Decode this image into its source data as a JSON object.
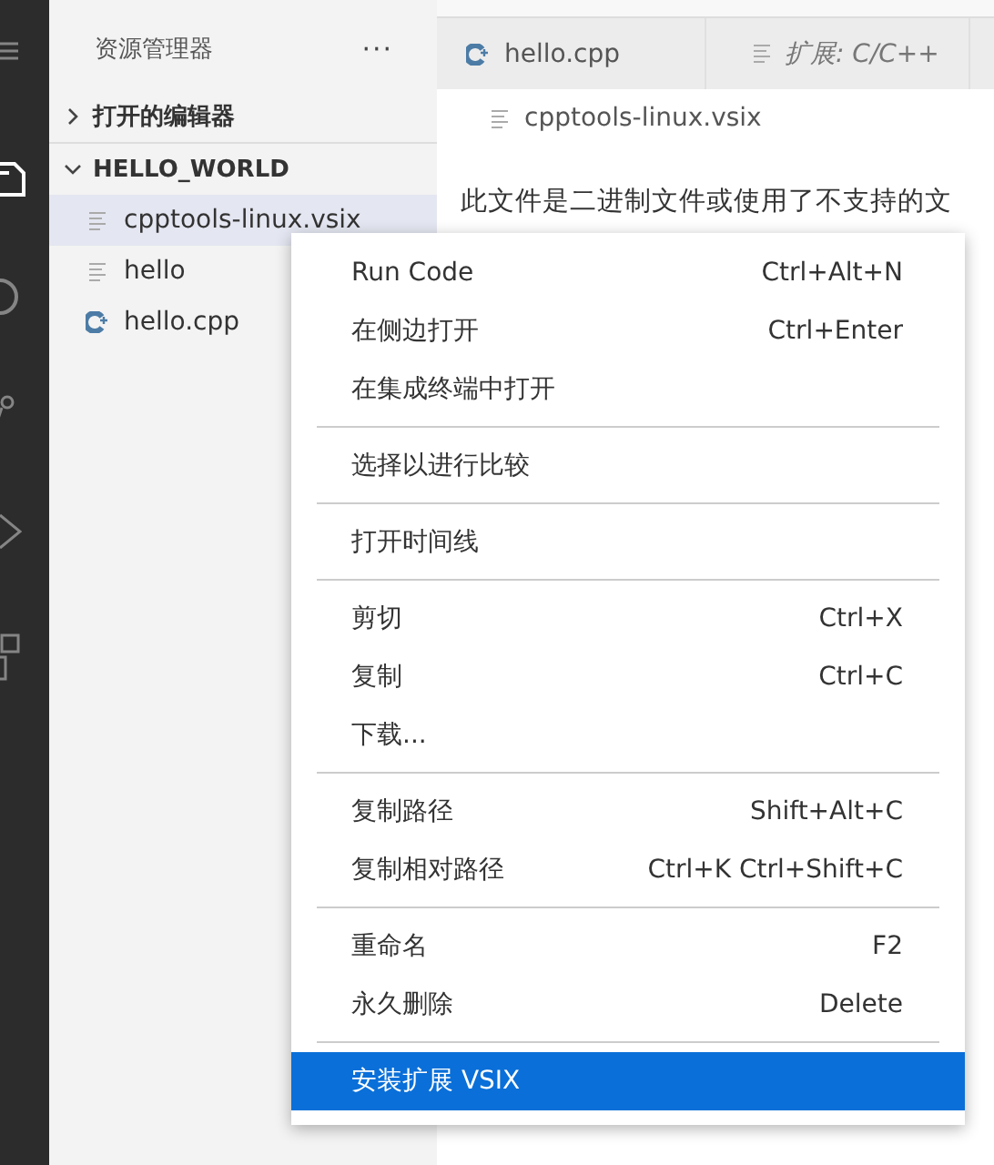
{
  "activity_bar": [
    {
      "kind": "menu",
      "selected": false
    },
    {
      "kind": "files",
      "selected": true
    },
    {
      "kind": "search",
      "selected": false
    },
    {
      "kind": "source-control",
      "selected": false
    },
    {
      "kind": "run",
      "selected": false
    },
    {
      "kind": "extensions",
      "selected": false
    }
  ],
  "sidebar": {
    "title": "资源管理器",
    "more": "···",
    "sections": [
      {
        "label": "打开的编辑器",
        "expanded": false
      },
      {
        "label": "HELLO_WORLD",
        "expanded": true,
        "files": [
          {
            "name": "cpptools-linux.vsix",
            "kind": "text",
            "selected": true
          },
          {
            "name": "hello",
            "kind": "text",
            "selected": false
          },
          {
            "name": "hello.cpp",
            "kind": "cpp",
            "selected": false
          }
        ]
      }
    ]
  },
  "tabs": [
    {
      "label": "hello.cpp",
      "kind": "cpp",
      "preview": false
    },
    {
      "label": "扩展: C/C++",
      "kind": "text",
      "preview": true
    }
  ],
  "breadcrumb": {
    "label": "cpptools-linux.vsix"
  },
  "message": "此文件是二进制文件或使用了不支持的文",
  "context_menu": {
    "groups": [
      [
        {
          "label": "Run Code",
          "shortcut": "Ctrl+Alt+N",
          "selected": false
        },
        {
          "label": "在侧边打开",
          "shortcut": "Ctrl+Enter",
          "selected": false
        },
        {
          "label": "在集成终端中打开",
          "selected": false
        }
      ],
      [
        {
          "label": "选择以进行比较",
          "selected": false
        }
      ],
      [
        {
          "label": "打开时间线",
          "selected": false
        }
      ],
      [
        {
          "label": "剪切",
          "shortcut": "Ctrl+X",
          "selected": false
        },
        {
          "label": "复制",
          "shortcut": "Ctrl+C",
          "selected": false
        },
        {
          "label": "下载...",
          "selected": false
        }
      ],
      [
        {
          "label": "复制路径",
          "shortcut": "Shift+Alt+C",
          "selected": false
        },
        {
          "label": "复制相对路径",
          "shortcut": "Ctrl+K Ctrl+Shift+C",
          "selected": false
        }
      ],
      [
        {
          "label": "重命名",
          "shortcut": "F2",
          "selected": false
        },
        {
          "label": "永久删除",
          "shortcut": "Delete",
          "selected": false
        }
      ],
      [
        {
          "label": "安装扩展 VSIX",
          "selected": true
        }
      ]
    ]
  }
}
